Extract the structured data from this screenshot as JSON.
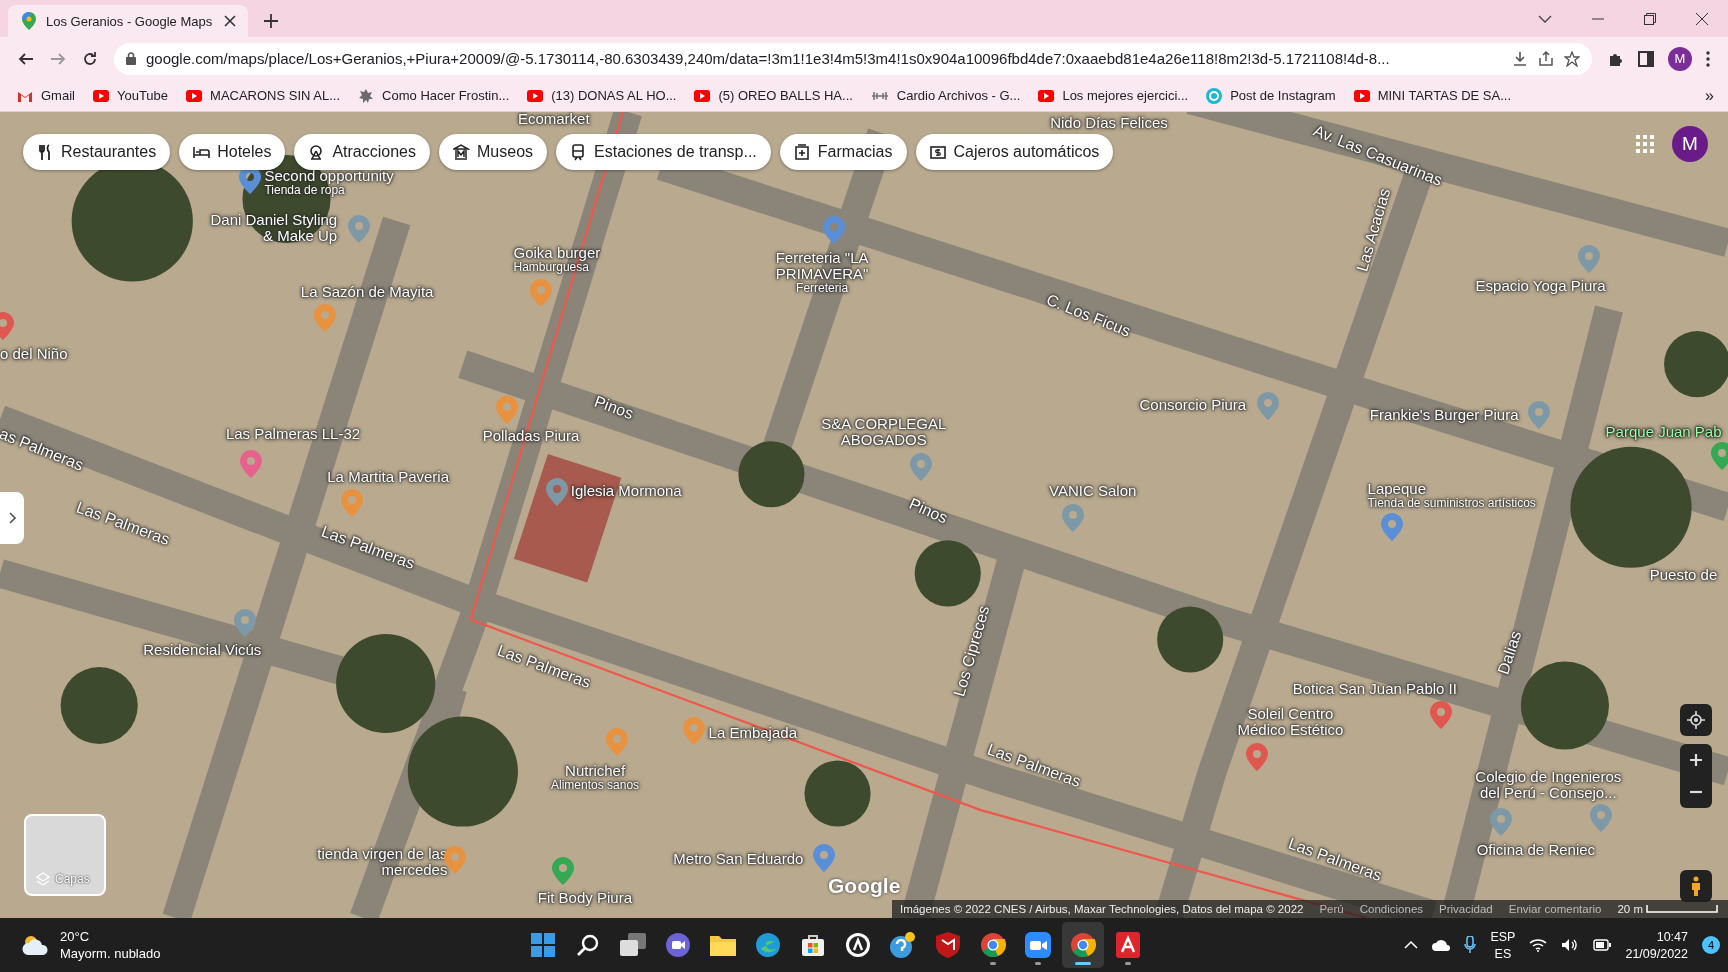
{
  "browser": {
    "tabs": [
      {
        "title": "Los Geranios - Google Maps",
        "selected": true
      }
    ],
    "address": "google.com/maps/place/Los+Geranios,+Piura+20009/@-5.1730114,-80.6303439,240m/data=!3m1!1e3!4m5!3m4!1s0x904a10096fbd4de7:0xaaebd81e4a26e118!8m2!3d-5.1721108!4d-8...",
    "profile_initial": "M",
    "bookmarks": [
      {
        "label": "Gmail",
        "kind": "gmail"
      },
      {
        "label": "YouTube",
        "kind": "youtube"
      },
      {
        "label": "MACARONS SIN AL...",
        "kind": "youtube"
      },
      {
        "label": "Como Hacer Frostin...",
        "kind": "leaf"
      },
      {
        "label": "(13) DONAS AL HO...",
        "kind": "youtube"
      },
      {
        "label": "(5) OREO BALLS HA...",
        "kind": "youtube"
      },
      {
        "label": "Cardio Archivos - G...",
        "kind": "gym"
      },
      {
        "label": "Los mejores ejercici...",
        "kind": "youtube"
      },
      {
        "label": "Post de Instagram",
        "kind": "canva"
      },
      {
        "label": "MINI TARTAS DE SA...",
        "kind": "youtube"
      }
    ],
    "bookmarks_more": "»"
  },
  "map": {
    "chips": [
      {
        "label": "Restaurantes",
        "kind": "restaurant"
      },
      {
        "label": "Hoteles",
        "kind": "hotel"
      },
      {
        "label": "Atracciones",
        "kind": "attraction"
      },
      {
        "label": "Museos",
        "kind": "museum"
      },
      {
        "label": "Estaciones de transp...",
        "kind": "transit"
      },
      {
        "label": "Farmacias",
        "kind": "pharmacy"
      },
      {
        "label": "Cajeros automáticos",
        "kind": "atm"
      }
    ],
    "account_initial": "M",
    "labels": [
      {
        "text": "Ecomarket",
        "kind": "place"
      },
      {
        "text": "Nido Días Felices",
        "kind": "place"
      },
      {
        "text": "Av. Las Casuarinas",
        "kind": "street"
      },
      {
        "text": "Second opportunity",
        "sub": "Tienda de ropa",
        "kind": "place",
        "color": "#5a8fd8"
      },
      {
        "text": "Dani Daniel Styling & Make Up",
        "kind": "place",
        "color": "#7d98a6"
      },
      {
        "text": "Goika burger",
        "sub": "Hamburguesa",
        "kind": "place",
        "color": "#e8913f"
      },
      {
        "text": "Ferreteria \"LA PRIMAVERA\"",
        "sub": "Ferreteria",
        "kind": "place",
        "color": "#5a8fd8"
      },
      {
        "text": "Las Acacias",
        "kind": "street"
      },
      {
        "text": "La Sazón de Mayita",
        "kind": "place",
        "color": "#e8913f"
      },
      {
        "text": "C. Los Ficus",
        "kind": "street"
      },
      {
        "text": "Espacio Yoga Piura",
        "kind": "place",
        "color": "#7d98a6"
      },
      {
        "text": "o del Niño",
        "kind": "place",
        "color": "#e0574f"
      },
      {
        "text": "as Palmeras",
        "kind": "street"
      },
      {
        "text": "Las Palmeras LL-32",
        "kind": "place",
        "color": "#e8618c"
      },
      {
        "text": "Polladas Piura",
        "kind": "place",
        "color": "#e8913f"
      },
      {
        "text": "Pinos",
        "kind": "street"
      },
      {
        "text": "S&A CORPLEGAL ABOGADOS",
        "kind": "place",
        "color": "#7d98a6"
      },
      {
        "text": "Consorcio Piura",
        "kind": "place",
        "color": "#7d98a6"
      },
      {
        "text": "Frankie's Burger Piura",
        "kind": "place",
        "color": "#7d98a6"
      },
      {
        "text": "Parque Juan Pab",
        "kind": "park",
        "color": "#34a853"
      },
      {
        "text": "La Martita Paveria",
        "kind": "place",
        "color": "#e8913f"
      },
      {
        "text": "Iglesia Mormona",
        "kind": "place",
        "color": "#7d98a6"
      },
      {
        "text": "Pinos",
        "kind": "street"
      },
      {
        "text": "VANIC Salon",
        "kind": "place",
        "color": "#7d98a6"
      },
      {
        "text": "Lapeque",
        "sub": "Tienda de suministros artísticos",
        "kind": "place",
        "color": "#5a8fd8"
      },
      {
        "text": "Las Palmeras",
        "kind": "street"
      },
      {
        "text": "Las Palmeras",
        "kind": "street"
      },
      {
        "text": "Puesto de",
        "kind": "place"
      },
      {
        "text": "Residencial Vicús",
        "kind": "place",
        "color": "#7d98a6"
      },
      {
        "text": "Las Palmeras",
        "kind": "street"
      },
      {
        "text": "Los Cipreces",
        "kind": "street"
      },
      {
        "text": "Botica San Juan Pablo II",
        "kind": "place",
        "color": "#e0574f"
      },
      {
        "text": "Dalias",
        "kind": "street"
      },
      {
        "text": "La Embajada",
        "kind": "place",
        "color": "#e8913f"
      },
      {
        "text": "Soleil Centro Médico Estético",
        "kind": "place",
        "color": "#e0574f"
      },
      {
        "text": "Nutrichef",
        "sub": "Alimentos sanos",
        "kind": "place",
        "color": "#e8913f"
      },
      {
        "text": "Las Palmeras",
        "kind": "street"
      },
      {
        "text": "Colegio de Ingenieros del Perú - Consejo...",
        "kind": "place",
        "color": "#7d98a6"
      },
      {
        "text": "tienda virgen de las mercedes",
        "kind": "place",
        "color": "#e8913f"
      },
      {
        "text": "Metro San Eduardo",
        "kind": "place",
        "color": "#5a8fd8"
      },
      {
        "text": "Las Palmeras",
        "kind": "street"
      },
      {
        "text": "Oficina de Reniec",
        "kind": "place",
        "color": "#7d98a6"
      },
      {
        "text": "Fit Body Piura",
        "kind": "place",
        "color": "#34a853"
      }
    ],
    "layers_label": "Capas",
    "google_logo": "Google",
    "attribution": "Imágenes © 2022 CNES / Airbus, Maxar Technologies, Datos del mapa © 2022",
    "footer_links": [
      "Perú",
      "Condiciones",
      "Privacidad",
      "Enviar comentario"
    ],
    "scale": "20 m"
  },
  "taskbar": {
    "temperature": "20°C",
    "weather": "Mayorm. nublado",
    "apps": [
      {
        "kind": "start",
        "running": false,
        "active": false
      },
      {
        "kind": "search",
        "running": false,
        "active": false
      },
      {
        "kind": "taskview",
        "running": false,
        "active": false
      },
      {
        "kind": "teams",
        "running": false,
        "active": false
      },
      {
        "kind": "explorer",
        "running": false,
        "active": false
      },
      {
        "kind": "edge",
        "running": false,
        "active": false
      },
      {
        "kind": "store",
        "running": false,
        "active": false
      },
      {
        "kind": "ring",
        "running": false,
        "active": false
      },
      {
        "kind": "help",
        "running": false,
        "active": false
      },
      {
        "kind": "shield",
        "running": false,
        "active": false
      },
      {
        "kind": "chrome",
        "running": true,
        "active": false
      },
      {
        "kind": "zoom",
        "running": true,
        "active": false
      },
      {
        "kind": "chrome",
        "running": true,
        "active": true
      },
      {
        "kind": "acrobat",
        "running": true,
        "active": false
      }
    ],
    "language": "ESP",
    "region": "ES",
    "time": "10:47",
    "date": "21/09/2022",
    "notifications": "4"
  }
}
